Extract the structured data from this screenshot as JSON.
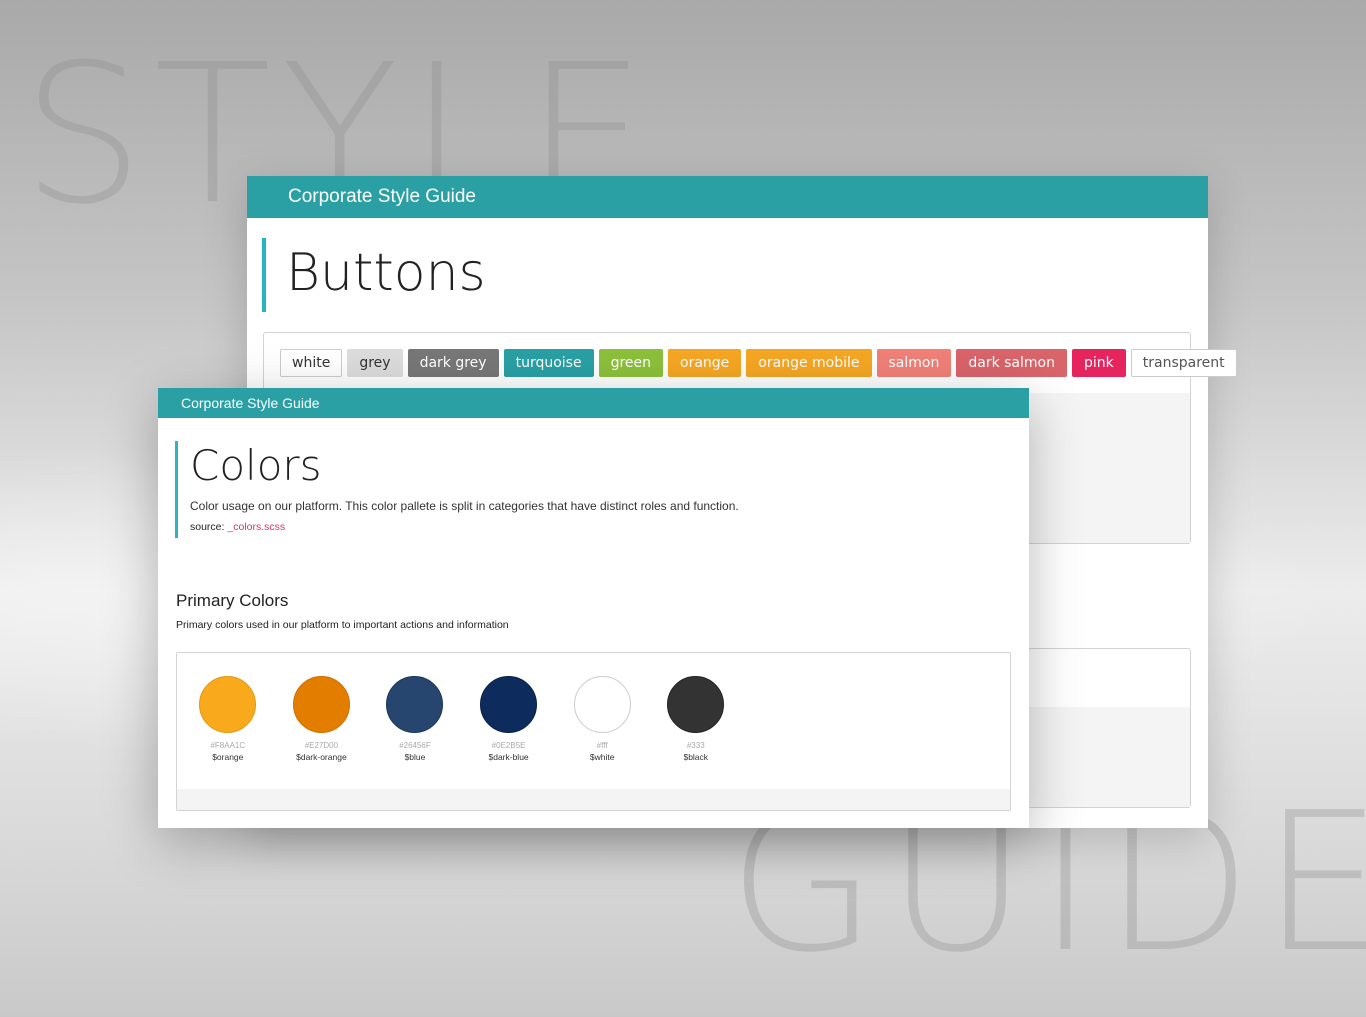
{
  "background": {
    "word_top": "STYLE",
    "word_bottom": "GUIDE"
  },
  "back_window": {
    "app_title": "Corporate Style Guide",
    "page_title": "Buttons",
    "buttons": [
      {
        "label": "white",
        "bg": "#ffffff",
        "color": "#333333",
        "border": "#cccccc"
      },
      {
        "label": "grey",
        "bg": "#dcdcdc",
        "color": "#333333",
        "border": "#dcdcdc"
      },
      {
        "label": "dark grey",
        "bg": "#777777",
        "color": "#ffffff",
        "border": "#777777"
      },
      {
        "label": "turquoise",
        "bg": "#2aa0a4",
        "color": "#ffffff",
        "border": "#2aa0a4"
      },
      {
        "label": "green",
        "bg": "#8cc03b",
        "color": "#ffffff",
        "border": "#8cc03b"
      },
      {
        "label": "orange",
        "bg": "#f5a623",
        "color": "#ffffff",
        "border": "#f5a623"
      },
      {
        "label": "orange mobile",
        "bg": "#f5a623",
        "color": "#ffffff",
        "border": "#f5a623"
      },
      {
        "label": "salmon",
        "bg": "#f08078",
        "color": "#ffffff",
        "border": "#f08078"
      },
      {
        "label": "dark salmon",
        "bg": "#d9646a",
        "color": "#ffffff",
        "border": "#d9646a"
      },
      {
        "label": "pink",
        "bg": "#e6245e",
        "color": "#ffffff",
        "border": "#e6245e"
      },
      {
        "label": "transparent",
        "bg": "#ffffff",
        "color": "#555555",
        "border": "#cccccc"
      }
    ]
  },
  "front_window": {
    "app_title": "Corporate Style Guide",
    "page_title": "Colors",
    "description": "Color usage on our platform. This color pallete is split in categories that have distinct roles and function.",
    "source_label": "source:",
    "source_link": "_colors.scss",
    "section_title": "Primary Colors",
    "section_subtitle": "Primary colors used in our platform to important actions and information",
    "swatches": [
      {
        "hex": "#F8AA1C",
        "var": "$orange",
        "color": "#f8aa1c",
        "border": "#e29912"
      },
      {
        "hex": "#E27D00",
        "var": "$dark-orange",
        "color": "#e27d00",
        "border": "#cf7100"
      },
      {
        "hex": "#26456F",
        "var": "$blue",
        "color": "#26456f",
        "border": "#1d375a"
      },
      {
        "hex": "#0E2B5E",
        "var": "$dark-blue",
        "color": "#0e2b5e",
        "border": "#0a2149"
      },
      {
        "hex": "#fff",
        "var": "$white",
        "color": "#ffffff",
        "border": "#cccccc"
      },
      {
        "hex": "#333",
        "var": "$black",
        "color": "#333333",
        "border": "#222222"
      }
    ]
  },
  "colors": {
    "topbar": "#2aa0a4",
    "accent_border": "#2ab6c0",
    "link": "#d6336c"
  }
}
